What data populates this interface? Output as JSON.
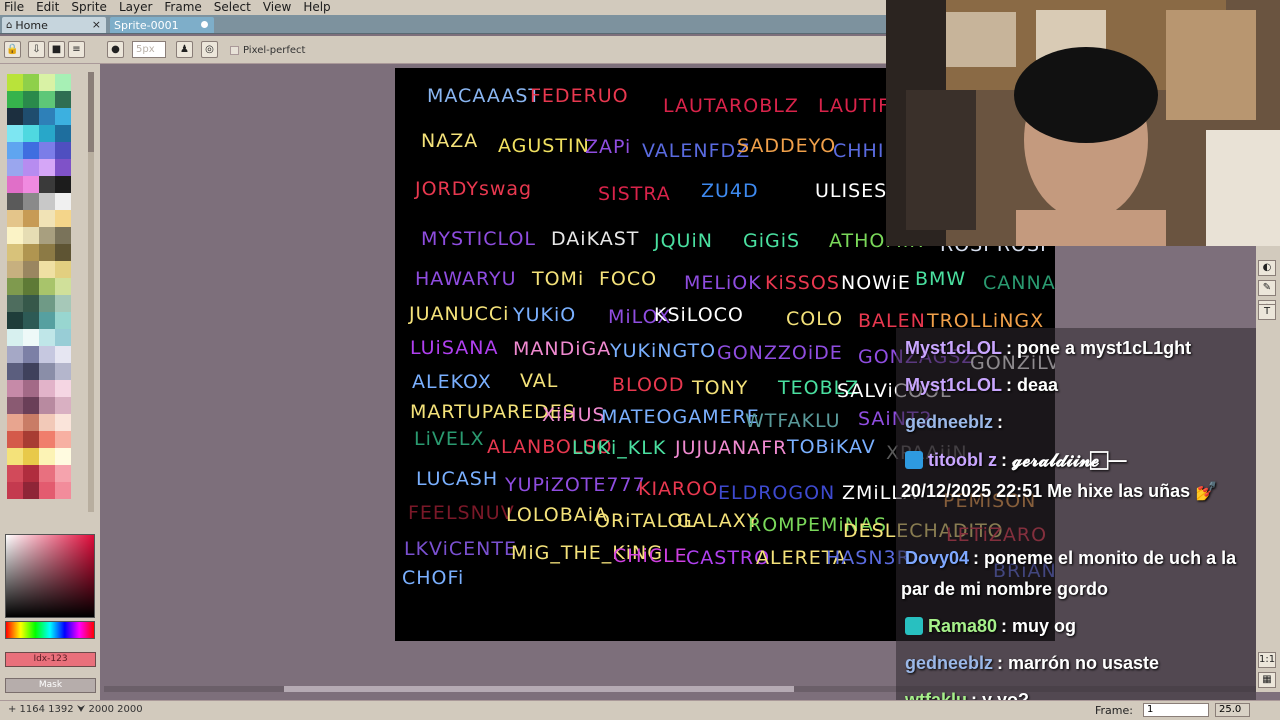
{
  "menu": [
    "File",
    "Edit",
    "Sprite",
    "Layer",
    "Frame",
    "Select",
    "View",
    "Help"
  ],
  "tabs": {
    "home": "Home",
    "sprite": "Sprite-0001",
    "close_glyph": "×"
  },
  "context": {
    "brush_size": "5px",
    "pixel_perfect": "Pixel-perfect"
  },
  "left": {
    "fg_color_label": "Idx-123",
    "mask_label": "Mask"
  },
  "palette_colors": [
    "#b9e33a",
    "#8ed04a",
    "#d9f2a5",
    "#a7f0b5",
    "#36b34c",
    "#2a8a4b",
    "#5ec778",
    "#2f6e52",
    "#1c2f3f",
    "#1f4d6e",
    "#2e80b8",
    "#3cb0e0",
    "#7de6f2",
    "#4fd8e0",
    "#28a7c9",
    "#1e6e9e",
    "#5fa5f0",
    "#3f6ee0",
    "#7b7de8",
    "#4f4fc0",
    "#9aa6ee",
    "#b78cf0",
    "#d5a6f7",
    "#7f52c8",
    "#e06fc8",
    "#f08ae0",
    "#3a3a3a",
    "#1c1c1c",
    "#5a5a5a",
    "#8a8a8a",
    "#c8c8c8",
    "#f0f0f0",
    "#e4c58a",
    "#c79b55",
    "#f1e3b6",
    "#f4d58a",
    "#fbf3c6",
    "#e6ddb4",
    "#a89f7f",
    "#7a735a",
    "#d8c27a",
    "#b09550",
    "#8c7a45",
    "#5e5433",
    "#c7b07f",
    "#9a8660",
    "#efe0a3",
    "#e2cf80",
    "#7f9a4e",
    "#5e7a36",
    "#a8c46b",
    "#d0e09a",
    "#4e6d5e",
    "#36584a",
    "#6f9a86",
    "#a6c8b8",
    "#1f3d3a",
    "#2d5a55",
    "#56a0a0",
    "#98d6d0",
    "#d7f0ef",
    "#eef9f8",
    "#bfe6e8",
    "#98cdd6",
    "#a5a8c6",
    "#7c80a6",
    "#c6c8e0",
    "#e6e6f2",
    "#5b5e7e",
    "#3f415c",
    "#8a8ea8",
    "#b4b6cc",
    "#c68aa8",
    "#a36a87",
    "#e2b3c9",
    "#f5d6e3",
    "#8a5a72",
    "#6a3f58",
    "#b88aa0",
    "#d9b0c2",
    "#e8a58f",
    "#c97c66",
    "#f2c9b8",
    "#fae4da",
    "#d45a4a",
    "#a83c33",
    "#f07e6c",
    "#f7b0a2",
    "#f4e27a",
    "#e8c94a",
    "#fcf3b5",
    "#fffbe0",
    "#d24a5a",
    "#b02d3e",
    "#e8707f",
    "#f5a3ad",
    "#c43a4f",
    "#8f2537",
    "#e35b6f",
    "#f28c9b"
  ],
  "canvas_names": [
    {
      "text": "MACAAAST",
      "color": "#8ab6f2"
    },
    {
      "text": "FEDERUO",
      "color": "#e8384f"
    },
    {
      "text": "LAUTAROBLZ",
      "color": "#d9234a"
    },
    {
      "text": "LAUTIFA",
      "color": "#d9234a"
    },
    {
      "text": "NAZA",
      "color": "#f4e27a"
    },
    {
      "text": "AGUSTIN",
      "color": "#f0e060"
    },
    {
      "text": "ZAPi",
      "color": "#8f4de0"
    },
    {
      "text": "VALENFDZ",
      "color": "#5a6be0"
    },
    {
      "text": "SADDEYO",
      "color": "#f0a04a"
    },
    {
      "text": "CHHIIN",
      "color": "#5a6be0"
    },
    {
      "text": "JORDYswag",
      "color": "#e8384f"
    },
    {
      "text": "SISTRA",
      "color": "#d9234a"
    },
    {
      "text": "ZU4D",
      "color": "#3e8af0"
    },
    {
      "text": "ULISES",
      "color": "#ffffff"
    },
    {
      "text": "MYSTICLOL",
      "color": "#8f4de0"
    },
    {
      "text": "DAiKAST",
      "color": "#e8e8e8"
    },
    {
      "text": "JQUiN",
      "color": "#4ae0a0"
    },
    {
      "text": "GiGiS",
      "color": "#4ae0a0"
    },
    {
      "text": "ATHOMIR",
      "color": "#7ad85a"
    },
    {
      "text": "ROSI ROSI",
      "color": "#d8e0f0"
    },
    {
      "text": "HAWARYU",
      "color": "#8f4de0"
    },
    {
      "text": "TOMi",
      "color": "#f4e27a"
    },
    {
      "text": "FOCO",
      "color": "#f4e27a"
    },
    {
      "text": "MELiOK",
      "color": "#8f4de0"
    },
    {
      "text": "KiSSOS",
      "color": "#e8384f"
    },
    {
      "text": "NOWiE",
      "color": "#ffffff"
    },
    {
      "text": "BMW",
      "color": "#4ae0a0"
    },
    {
      "text": "CANNA",
      "color": "#2a9a70"
    },
    {
      "text": "JUANUCCi",
      "color": "#f4e27a"
    },
    {
      "text": "YUKiO",
      "color": "#7ab0ff"
    },
    {
      "text": "MiLOX",
      "color": "#8f4de0"
    },
    {
      "text": "KSiLOCO",
      "color": "#ffffff"
    },
    {
      "text": "COLO",
      "color": "#f4e27a"
    },
    {
      "text": "BALEN",
      "color": "#e8384f"
    },
    {
      "text": "TROLLiNGX",
      "color": "#f0a04a"
    },
    {
      "text": "LUiSANA",
      "color": "#b040f0"
    },
    {
      "text": "MANDiGA",
      "color": "#f08ad0"
    },
    {
      "text": "YUKiNGTO",
      "color": "#7ab0ff"
    },
    {
      "text": "GONZZOiDE",
      "color": "#8f4de0"
    },
    {
      "text": "GONZAGSZ",
      "color": "#8f4de0"
    },
    {
      "text": "GONZiLVA",
      "color": "#ffffff"
    },
    {
      "text": "ALEKOX",
      "color": "#7ab0ff"
    },
    {
      "text": "VAL",
      "color": "#f4e27a"
    },
    {
      "text": "BLOOD",
      "color": "#e8384f"
    },
    {
      "text": "TONY",
      "color": "#f4e27a"
    },
    {
      "text": "TEOBLZ",
      "color": "#4ae0a0"
    },
    {
      "text": "SALViCOOL",
      "color": "#ffffff"
    },
    {
      "text": "MARTUPAREDES",
      "color": "#f4e27a"
    },
    {
      "text": "XiHUS",
      "color": "#f08ad0"
    },
    {
      "text": "MATEOGAMERE",
      "color": "#7ab0ff"
    },
    {
      "text": "WTFAKLU",
      "color": "#5a9a9a"
    },
    {
      "text": "SAiNT2",
      "color": "#8f4de0"
    },
    {
      "text": "LiVELX",
      "color": "#2a9a70"
    },
    {
      "text": "ALANBOLSO",
      "color": "#e8384f"
    },
    {
      "text": "LUKi_KLK",
      "color": "#4ae0a0"
    },
    {
      "text": "JUJUANAFR",
      "color": "#f08ad0"
    },
    {
      "text": "TOBiKAV",
      "color": "#7ab0ff"
    },
    {
      "text": "XPAAiiN",
      "color": "#5a5a5a"
    },
    {
      "text": "LUCASH",
      "color": "#7ab0ff"
    },
    {
      "text": "YUPiZOTE777",
      "color": "#8f4de0"
    },
    {
      "text": "KIAROO",
      "color": "#e8384f"
    },
    {
      "text": "ELDROGON",
      "color": "#3e4ad0"
    },
    {
      "text": "ZMiLLA",
      "color": "#ffffff"
    },
    {
      "text": "PEMiSON",
      "color": "#f0a04a"
    },
    {
      "text": "FEELSNUV",
      "color": "#7a1828"
    },
    {
      "text": "LOLOBAiA",
      "color": "#f4e27a"
    },
    {
      "text": "ORiTALOL",
      "color": "#f4e27a"
    },
    {
      "text": "GALAXY",
      "color": "#f4e27a"
    },
    {
      "text": "ROMPEMiNAS",
      "color": "#7ad85a"
    },
    {
      "text": "DESLECHADITO",
      "color": "#f4e27a"
    },
    {
      "text": "LETiZARO",
      "color": "#e8384f"
    },
    {
      "text": "LKViCENTE",
      "color": "#7a50d0"
    },
    {
      "text": "MiG_THE_KiNG",
      "color": "#f4e27a"
    },
    {
      "text": "CHiCLE",
      "color": "#d040e0"
    },
    {
      "text": "CASTRO",
      "color": "#b040f0"
    },
    {
      "text": "ALERETA",
      "color": "#f4e27a"
    },
    {
      "text": "HASN3R",
      "color": "#5a6be0"
    },
    {
      "text": "BRiANXLO",
      "color": "#5a6be0"
    },
    {
      "text": "CHOFi",
      "color": "#7ab0ff"
    }
  ],
  "chat": [
    {
      "user": "Myst1cLOL",
      "user_color": "#c9a6ff",
      "text": ": pone a myst1cL1ght"
    },
    {
      "user": "Myst1cLOL",
      "user_color": "#c9a6ff",
      "text": ": deaa"
    },
    {
      "user": "gedneeblz",
      "user_color": "#9bb8e8",
      "text": ":"
    },
    {
      "user": "titoobl z",
      "user_color": "#c9a6ff",
      "text": ": 𝓰𝓮𝓻𝓪𝓵𝓭𝓲𝓲𝓷𝓮 ⃞ —"
    },
    {
      "user": "",
      "user_color": "#ffffff",
      "text": "20/12/2025 22:51 Me hixe las uñas 💅"
    },
    {
      "user": "Dovy04",
      "user_color": "#7fa8ff",
      "text": ": poneme el monito de uch a la"
    },
    {
      "user": "",
      "user_color": "#ffffff",
      "text": "par de mi nombre gordo"
    },
    {
      "user": "Rama80",
      "user_color": "#a6f08a",
      "text": ": muy og"
    },
    {
      "user": "gedneeblz",
      "user_color": "#9bb8e8",
      "text": ": marrón no usaste"
    },
    {
      "user": "wtfaklu",
      "user_color": "#a6f08a",
      "text": ": y yo?"
    }
  ],
  "status": {
    "text": "+ 1164 1392  ⮟ 2000 2000",
    "frame_label": "Frame:",
    "frame_value": "1",
    "zoom": "25.0"
  }
}
